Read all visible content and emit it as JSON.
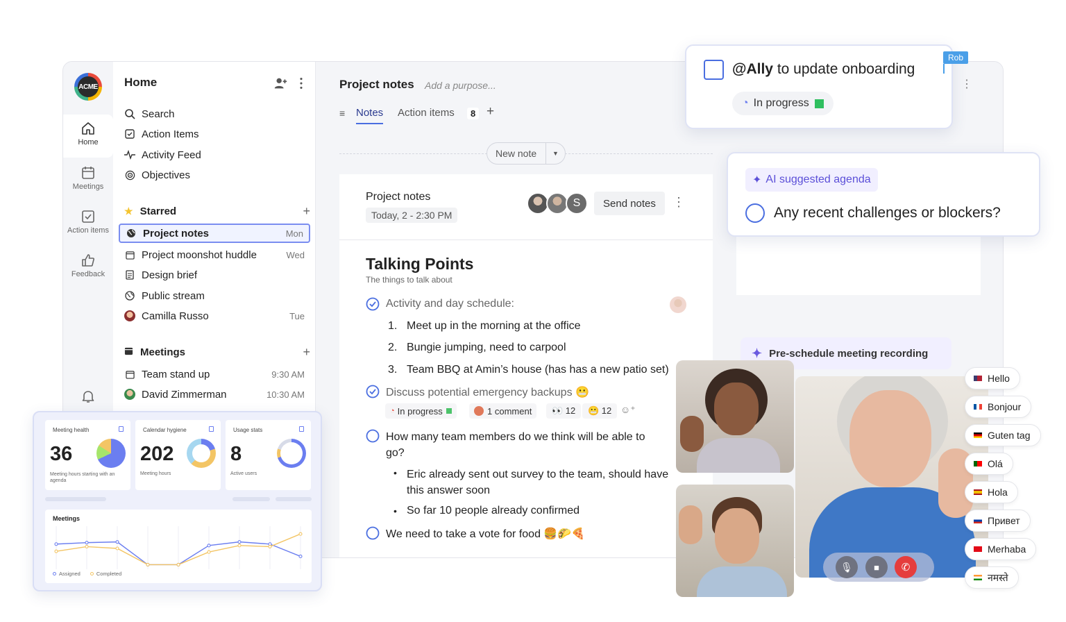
{
  "rail": {
    "logo_text": "ACME",
    "items": [
      {
        "label": "Home",
        "icon": "home-icon"
      },
      {
        "label": "Meetings",
        "icon": "calendar-icon"
      },
      {
        "label": "Action items",
        "icon": "checkbox-icon"
      },
      {
        "label": "Feedback",
        "icon": "thumbs-up-icon"
      }
    ]
  },
  "sidebar": {
    "title": "Home",
    "nav": [
      "Search",
      "Action Items",
      "Activity Feed",
      "Objectives"
    ],
    "starred_heading": "Starred",
    "starred": [
      {
        "label": "Project notes",
        "meta": "Mon"
      },
      {
        "label": "Project moonshot huddle",
        "meta": "Wed"
      },
      {
        "label": "Design brief",
        "meta": ""
      },
      {
        "label": "Public stream",
        "meta": ""
      },
      {
        "label": "Camilla Russo",
        "meta": "Tue"
      }
    ],
    "meetings_heading": "Meetings",
    "meetings": [
      {
        "label": "Team stand up",
        "meta": "9:30 AM"
      },
      {
        "label": "David Zimmerman",
        "meta": "10:30 AM"
      }
    ]
  },
  "header": {
    "title": "Project notes",
    "purpose_placeholder": "Add a purpose...",
    "tabs": [
      {
        "label": "Notes"
      },
      {
        "label": "Action items",
        "count": "8"
      }
    ],
    "new_note": "New note"
  },
  "note": {
    "title": "Project notes",
    "date": "Today, 2 - 2:30 PM",
    "avatar_initial": "S",
    "send_notes": "Send notes",
    "section_title": "Talking Points",
    "section_subtitle": "The things to talk about",
    "item1": "Activity and day schedule:",
    "item1_list": [
      "Meet up in the morning at the office",
      "Bungie jumping, need to carpool",
      "Team BBQ at Amin’s house (has has a new patio set)"
    ],
    "item1_nums": [
      "1.",
      "2.",
      "3."
    ],
    "item2": "Discuss potential emergency backups 😬",
    "item2_status": "In progress",
    "item2_comment": "1 comment",
    "item2_react1": "👀 12",
    "item2_react2": "😬 12",
    "item3": "How many team members do we think will be able to go?",
    "item3_bullets": [
      "Eric already sent out survey to the team, should have this answer soon",
      "So far 10 people already confirmed"
    ],
    "item4": "We need to take a vote for food 🍔🌮🍕"
  },
  "task_card": {
    "mention": "@Ally",
    "text": " to update onboarding",
    "status": "In progress",
    "tag": "Rob"
  },
  "agenda_card": {
    "label": "AI suggested agenda",
    "question": "Any recent challenges or blockers?"
  },
  "recording": {
    "label": "Pre-schedule meeting recording"
  },
  "languages": [
    "Hello",
    "Bonjour",
    "Guten tag",
    "Olá",
    "Hola",
    "Привет",
    "Merhaba",
    "नमस्ते"
  ],
  "stats": {
    "cards": [
      {
        "title": "Meeting health",
        "value": "36",
        "caption": "Meeting hours starting with an agenda"
      },
      {
        "title": "Calendar hygiene",
        "value": "202",
        "caption": "Meeting hours"
      },
      {
        "title": "Usage stats",
        "value": "8",
        "caption": "Active users"
      }
    ],
    "chart_title": "Meetings",
    "legend": [
      "Assigned",
      "Completed"
    ]
  },
  "chart_data": {
    "type": "line",
    "title": "Meetings",
    "x": [
      1,
      2,
      3,
      4,
      5,
      6,
      7,
      8,
      9
    ],
    "series": [
      {
        "name": "Assigned",
        "values": [
          0.62,
          0.66,
          0.68,
          0.05,
          0.05,
          0.58,
          0.68,
          0.62,
          0.28
        ]
      },
      {
        "name": "Completed",
        "values": [
          0.42,
          0.55,
          0.5,
          0.05,
          0.05,
          0.4,
          0.58,
          0.55,
          0.9
        ]
      }
    ],
    "ylim": [
      0,
      1
    ],
    "colors": [
      "#6b7ef0",
      "#f3c565"
    ]
  }
}
